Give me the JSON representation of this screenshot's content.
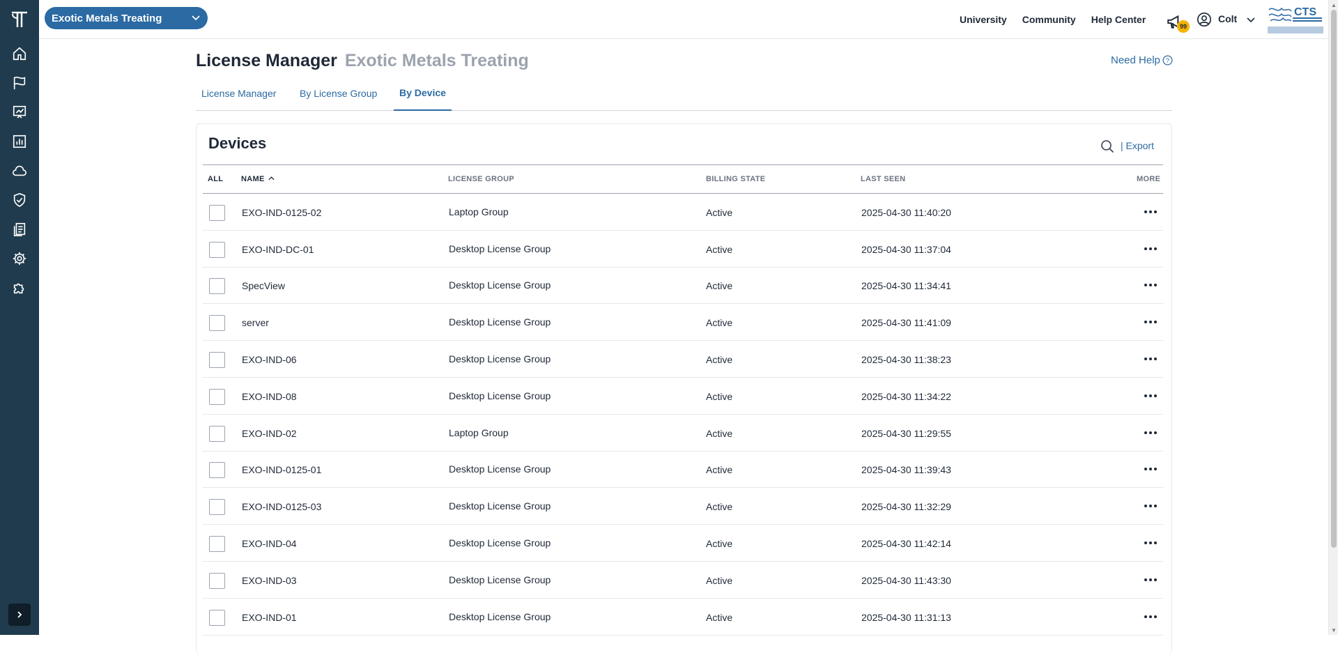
{
  "app": {
    "org_selector": "Exotic Metals Treating",
    "nav_icons": [
      "home-icon",
      "flag-icon",
      "presentation-chart-icon",
      "bar-chart-icon",
      "cloud-icon",
      "shield-check-icon",
      "clipboard-list-icon",
      "gear-icon",
      "puzzle-icon"
    ]
  },
  "topbar": {
    "links": [
      "University",
      "Community",
      "Help Center"
    ],
    "notification_count": "99",
    "user_name": "Colt"
  },
  "page": {
    "title": "License Manager",
    "subtitle": "Exotic Metals Treating",
    "need_help": "Need Help",
    "tabs": [
      {
        "label": "License Manager",
        "active": false
      },
      {
        "label": "By License Group",
        "active": false
      },
      {
        "label": "By Device",
        "active": true
      }
    ]
  },
  "devices": {
    "title": "Devices",
    "export_label": "| Export",
    "columns": {
      "all": "ALL",
      "name": "NAME",
      "license_group": "LICENSE GROUP",
      "billing_state": "BILLING STATE",
      "last_seen": "LAST SEEN",
      "more": "MORE"
    },
    "rows": [
      {
        "name": "EXO-IND-0125-02",
        "group": "Laptop Group",
        "state": "Active",
        "seen": "2025-04-30 11:40:20"
      },
      {
        "name": "EXO-IND-DC-01",
        "group": "Desktop License Group",
        "state": "Active",
        "seen": "2025-04-30 11:37:04"
      },
      {
        "name": "SpecView",
        "group": "Desktop License Group",
        "state": "Active",
        "seen": "2025-04-30 11:34:41"
      },
      {
        "name": "server",
        "group": "Desktop License Group",
        "state": "Active",
        "seen": "2025-04-30 11:41:09"
      },
      {
        "name": "EXO-IND-06",
        "group": "Desktop License Group",
        "state": "Active",
        "seen": "2025-04-30 11:38:23"
      },
      {
        "name": "EXO-IND-08",
        "group": "Desktop License Group",
        "state": "Active",
        "seen": "2025-04-30 11:34:22"
      },
      {
        "name": "EXO-IND-02",
        "group": "Laptop Group",
        "state": "Active",
        "seen": "2025-04-30 11:29:55"
      },
      {
        "name": "EXO-IND-0125-01",
        "group": "Desktop License Group",
        "state": "Active",
        "seen": "2025-04-30 11:39:43"
      },
      {
        "name": "EXO-IND-0125-03",
        "group": "Desktop License Group",
        "state": "Active",
        "seen": "2025-04-30 11:32:29"
      },
      {
        "name": "EXO-IND-04",
        "group": "Desktop License Group",
        "state": "Active",
        "seen": "2025-04-30 11:42:14"
      },
      {
        "name": "EXO-IND-03",
        "group": "Desktop License Group",
        "state": "Active",
        "seen": "2025-04-30 11:43:30"
      },
      {
        "name": "EXO-IND-01",
        "group": "Desktop License Group",
        "state": "Active",
        "seen": "2025-04-30 11:31:13"
      }
    ]
  },
  "colors": {
    "rail": "#1f3b4d",
    "accent": "#2b6aa3",
    "badge": "#f5b400"
  }
}
